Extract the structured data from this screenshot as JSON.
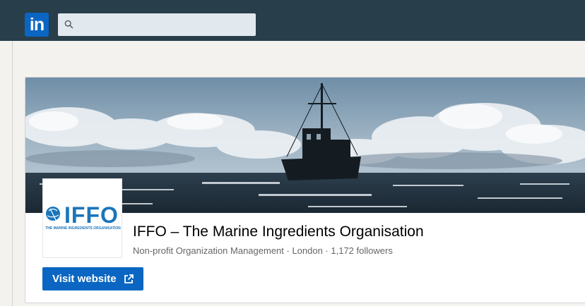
{
  "nav": {
    "logo_text": "in",
    "search_value": "",
    "search_placeholder": ""
  },
  "org": {
    "logo_word": "IFFO",
    "logo_tagline": "THE MARINE INGREDIENTS ORGANISATION",
    "name": "IFFO – The Marine Ingredients Organisation",
    "industry": "Non-profit Organization Management",
    "location": "London",
    "followers": "1,172 followers",
    "meta": "Non-profit Organization Management · London · 1,172 followers"
  },
  "actions": {
    "visit_website": "Visit website"
  },
  "colors": {
    "nav_bg": "#283e4a",
    "brand_blue": "#0a66c2",
    "logo_blue": "#1b75bb"
  }
}
